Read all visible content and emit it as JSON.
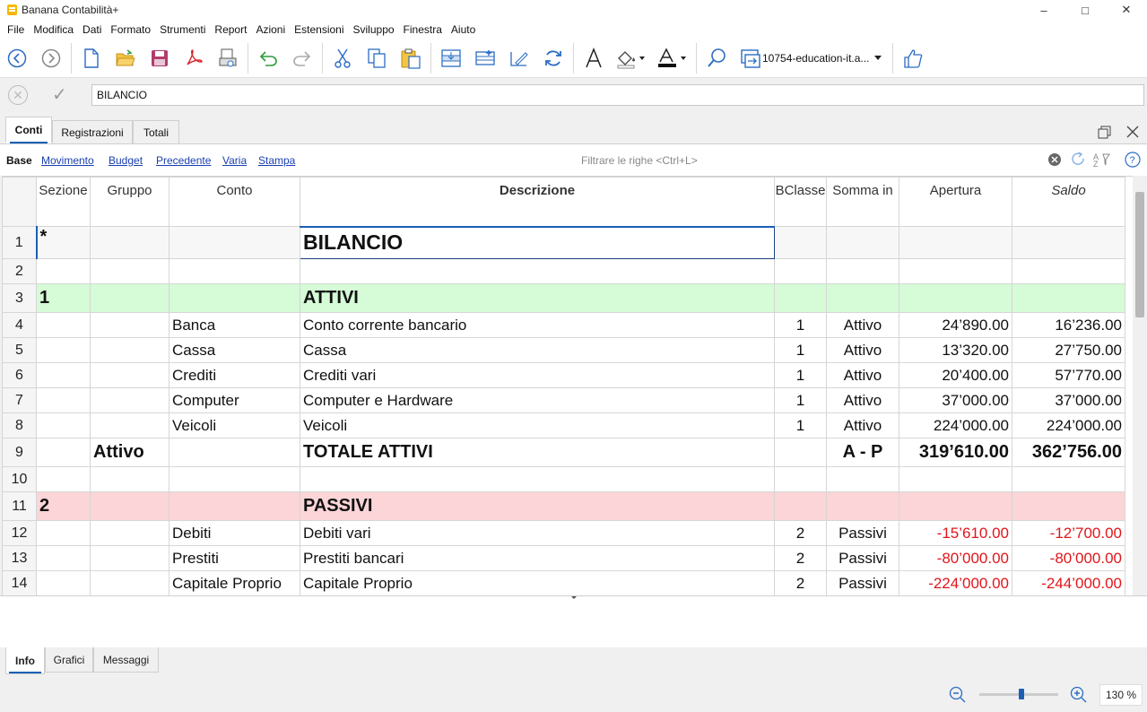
{
  "window": {
    "title": "Banana Contabilità+"
  },
  "menu": [
    "File",
    "Modifica",
    "Dati",
    "Formato",
    "Strumenti",
    "Report",
    "Azioni",
    "Estensioni",
    "Sviluppo",
    "Finestra",
    "Aiuto"
  ],
  "toolbar": {
    "file_combo": "10754-education-it.a..."
  },
  "editbar": {
    "value": "BILANCIO"
  },
  "tabs": [
    "Conti",
    "Registrazioni",
    "Totali"
  ],
  "views": [
    "Base",
    "Movimento",
    "Budget",
    "Precedente",
    "Varia",
    "Stampa"
  ],
  "filter": {
    "placeholder": "Filtrare le righe <Ctrl+L>"
  },
  "columns": [
    "Sezione",
    "Gruppo",
    "Conto",
    "Descrizione",
    "BClasse",
    "Somma in",
    "Apertura",
    "Saldo"
  ],
  "rows": [
    {
      "n": "1",
      "sezione": "*",
      "gruppo": "",
      "conto": "",
      "descr": "BILANCIO",
      "bclasse": "",
      "somma": "",
      "apertura": "",
      "saldo": ""
    },
    {
      "n": "2",
      "sezione": "",
      "gruppo": "",
      "conto": "",
      "descr": "",
      "bclasse": "",
      "somma": "",
      "apertura": "",
      "saldo": ""
    },
    {
      "n": "3",
      "sezione": "1",
      "gruppo": "",
      "conto": "",
      "descr": "ATTIVI",
      "bclasse": "",
      "somma": "",
      "apertura": "",
      "saldo": ""
    },
    {
      "n": "4",
      "sezione": "",
      "gruppo": "",
      "conto": "Banca",
      "descr": "Conto corrente bancario",
      "bclasse": "1",
      "somma": "Attivo",
      "apertura": "24’890.00",
      "saldo": "16’236.00"
    },
    {
      "n": "5",
      "sezione": "",
      "gruppo": "",
      "conto": "Cassa",
      "descr": "Cassa",
      "bclasse": "1",
      "somma": "Attivo",
      "apertura": "13’320.00",
      "saldo": "27’750.00"
    },
    {
      "n": "6",
      "sezione": "",
      "gruppo": "",
      "conto": "Crediti",
      "descr": "Crediti vari",
      "bclasse": "1",
      "somma": "Attivo",
      "apertura": "20’400.00",
      "saldo": "57’770.00"
    },
    {
      "n": "7",
      "sezione": "",
      "gruppo": "",
      "conto": "Computer",
      "descr": "Computer e Hardware",
      "bclasse": "1",
      "somma": "Attivo",
      "apertura": "37’000.00",
      "saldo": "37’000.00"
    },
    {
      "n": "8",
      "sezione": "",
      "gruppo": "",
      "conto": "Veicoli",
      "descr": "Veicoli",
      "bclasse": "1",
      "somma": "Attivo",
      "apertura": "224’000.00",
      "saldo": "224’000.00"
    },
    {
      "n": "9",
      "sezione": "",
      "gruppo": "Attivo",
      "conto": "",
      "descr": "TOTALE ATTIVI",
      "bclasse": "",
      "somma": "A - P",
      "apertura": "319’610.00",
      "saldo": "362’756.00"
    },
    {
      "n": "10",
      "sezione": "",
      "gruppo": "",
      "conto": "",
      "descr": "",
      "bclasse": "",
      "somma": "",
      "apertura": "",
      "saldo": ""
    },
    {
      "n": "11",
      "sezione": "2",
      "gruppo": "",
      "conto": "",
      "descr": "PASSIVI",
      "bclasse": "",
      "somma": "",
      "apertura": "",
      "saldo": ""
    },
    {
      "n": "12",
      "sezione": "",
      "gruppo": "",
      "conto": "Debiti",
      "descr": "Debiti vari",
      "bclasse": "2",
      "somma": "Passivi",
      "apertura": "-15’610.00",
      "saldo": "-12’700.00"
    },
    {
      "n": "13",
      "sezione": "",
      "gruppo": "",
      "conto": "Prestiti",
      "descr": "Prestiti bancari",
      "bclasse": "2",
      "somma": "Passivi",
      "apertura": "-80’000.00",
      "saldo": "-80’000.00"
    },
    {
      "n": "14",
      "sezione": "",
      "gruppo": "",
      "conto": "Capitale Proprio",
      "descr": "Capitale Proprio",
      "bclasse": "2",
      "somma": "Passivi",
      "apertura": "-224’000.00",
      "saldo": "-244’000.00"
    }
  ],
  "bottom_tabs": [
    "Info",
    "Grafici",
    "Messaggi"
  ],
  "status": {
    "zoom": "130 %"
  },
  "colors": {
    "attivi_row": "#d5fbd7",
    "passivi_row": "#fbd5d7",
    "negative": "#e0161b",
    "accent": "#1a5fb4"
  }
}
